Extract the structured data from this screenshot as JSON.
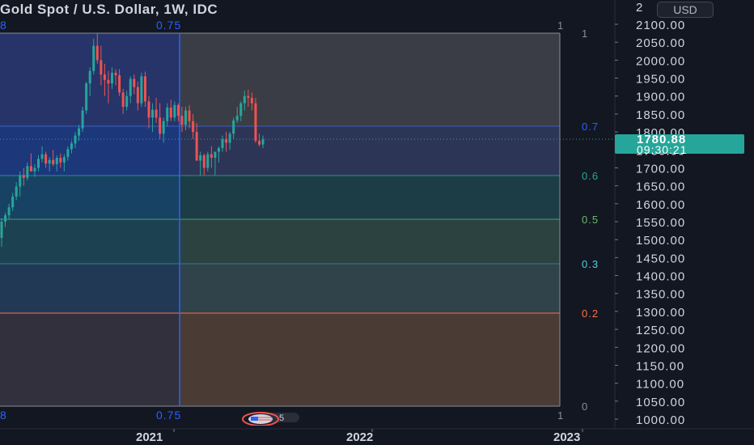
{
  "header": {
    "title": "Gold Spot / U.S. Dollar, 1W, IDC",
    "currency": "USD"
  },
  "price_axis": {
    "top_partial": "2",
    "labels": [
      "2100.00",
      "2050.00",
      "2000.00",
      "1950.00",
      "1900.00",
      "1850.00",
      "1800.00",
      "1750.00",
      "1700.00",
      "1650.00",
      "1600.00",
      "1550.00",
      "1500.00",
      "1450.00",
      "1400.00",
      "1350.00",
      "1300.00",
      "1250.00",
      "1200.00",
      "1150.00",
      "1100.00",
      "1050.00",
      "1000.00"
    ]
  },
  "current_price": {
    "price": "1780.88",
    "countdown": "09:30:21"
  },
  "time_axis": {
    "labels": [
      "2021",
      "2022",
      "2023"
    ]
  },
  "fib_time_levels": {
    "top": [
      "8",
      "0.75",
      "1"
    ],
    "bottom": [
      "8",
      "0.75",
      "1"
    ]
  },
  "fib_price_levels": {
    "labels": [
      "1",
      "0.7",
      "0.6",
      "0.5",
      "0.3",
      "0.2",
      "0"
    ]
  },
  "badges": {
    "events_count": "5"
  },
  "colors": {
    "background": "#131722",
    "up": "#26a69a",
    "down": "#ef5350",
    "fib_time_line": "#2962ff",
    "current_price": "#26a69a"
  },
  "chart_data": {
    "type": "candlestick",
    "title": "Gold Spot / U.S. Dollar, 1W, IDC",
    "ylim": [
      1000,
      2100
    ],
    "x_ticks": [
      "2021",
      "2022",
      "2023"
    ],
    "last_price": 1780.88,
    "ohlc": [
      [
        1505,
        1560,
        1480,
        1550
      ],
      [
        1550,
        1575,
        1535,
        1568
      ],
      [
        1568,
        1600,
        1555,
        1590
      ],
      [
        1590,
        1630,
        1580,
        1620
      ],
      [
        1620,
        1660,
        1610,
        1648
      ],
      [
        1648,
        1690,
        1620,
        1680
      ],
      [
        1680,
        1700,
        1650,
        1672
      ],
      [
        1672,
        1715,
        1665,
        1705
      ],
      [
        1705,
        1740,
        1695,
        1690
      ],
      [
        1690,
        1710,
        1675,
        1700
      ],
      [
        1700,
        1735,
        1690,
        1725
      ],
      [
        1725,
        1760,
        1715,
        1738
      ],
      [
        1738,
        1745,
        1700,
        1712
      ],
      [
        1712,
        1730,
        1690,
        1722
      ],
      [
        1722,
        1750,
        1705,
        1710
      ],
      [
        1710,
        1735,
        1690,
        1728
      ],
      [
        1728,
        1740,
        1700,
        1715
      ],
      [
        1715,
        1738,
        1690,
        1730
      ],
      [
        1730,
        1760,
        1720,
        1752
      ],
      [
        1752,
        1775,
        1740,
        1768
      ],
      [
        1768,
        1800,
        1755,
        1790
      ],
      [
        1790,
        1820,
        1775,
        1810
      ],
      [
        1810,
        1870,
        1800,
        1860
      ],
      [
        1860,
        1940,
        1850,
        1935
      ],
      [
        1935,
        1980,
        1900,
        1970
      ],
      [
        1970,
        2060,
        1960,
        2040
      ],
      [
        2040,
        2074,
        1990,
        2000
      ],
      [
        2000,
        2040,
        1930,
        1960
      ],
      [
        1960,
        1990,
        1900,
        1945
      ],
      [
        1945,
        1970,
        1880,
        1935
      ],
      [
        1935,
        1980,
        1920,
        1965
      ],
      [
        1965,
        1975,
        1930,
        1958
      ],
      [
        1958,
        1975,
        1900,
        1910
      ],
      [
        1910,
        1920,
        1850,
        1870
      ],
      [
        1870,
        1915,
        1860,
        1900
      ],
      [
        1900,
        1955,
        1880,
        1948
      ],
      [
        1948,
        1960,
        1905,
        1925
      ],
      [
        1925,
        1940,
        1860,
        1880
      ],
      [
        1880,
        1965,
        1870,
        1955
      ],
      [
        1955,
        1968,
        1870,
        1885
      ],
      [
        1885,
        1900,
        1810,
        1840
      ],
      [
        1840,
        1880,
        1800,
        1862
      ],
      [
        1862,
        1895,
        1825,
        1840
      ],
      [
        1840,
        1880,
        1780,
        1795
      ],
      [
        1795,
        1840,
        1770,
        1830
      ],
      [
        1830,
        1880,
        1815,
        1868
      ],
      [
        1868,
        1890,
        1830,
        1840
      ],
      [
        1840,
        1885,
        1830,
        1875
      ],
      [
        1875,
        1880,
        1830,
        1845
      ],
      [
        1845,
        1870,
        1800,
        1820
      ],
      [
        1820,
        1870,
        1805,
        1860
      ],
      [
        1860,
        1875,
        1810,
        1830
      ],
      [
        1830,
        1850,
        1780,
        1800
      ],
      [
        1800,
        1825,
        1760,
        1720
      ],
      [
        1720,
        1745,
        1680,
        1735
      ],
      [
        1735,
        1740,
        1680,
        1700
      ],
      [
        1700,
        1745,
        1690,
        1738
      ],
      [
        1738,
        1760,
        1700,
        1728
      ],
      [
        1728,
        1745,
        1680,
        1745
      ],
      [
        1745,
        1760,
        1715,
        1755
      ],
      [
        1755,
        1790,
        1745,
        1780
      ],
      [
        1780,
        1800,
        1745,
        1770
      ],
      [
        1770,
        1800,
        1750,
        1795
      ],
      [
        1795,
        1840,
        1780,
        1832
      ],
      [
        1832,
        1870,
        1825,
        1845
      ],
      [
        1845,
        1885,
        1830,
        1880
      ],
      [
        1880,
        1915,
        1860,
        1900
      ],
      [
        1900,
        1918,
        1870,
        1895
      ],
      [
        1895,
        1910,
        1860,
        1880
      ],
      [
        1880,
        1895,
        1770,
        1775
      ],
      [
        1775,
        1795,
        1760,
        1765
      ],
      [
        1765,
        1790,
        1755,
        1780
      ]
    ]
  }
}
